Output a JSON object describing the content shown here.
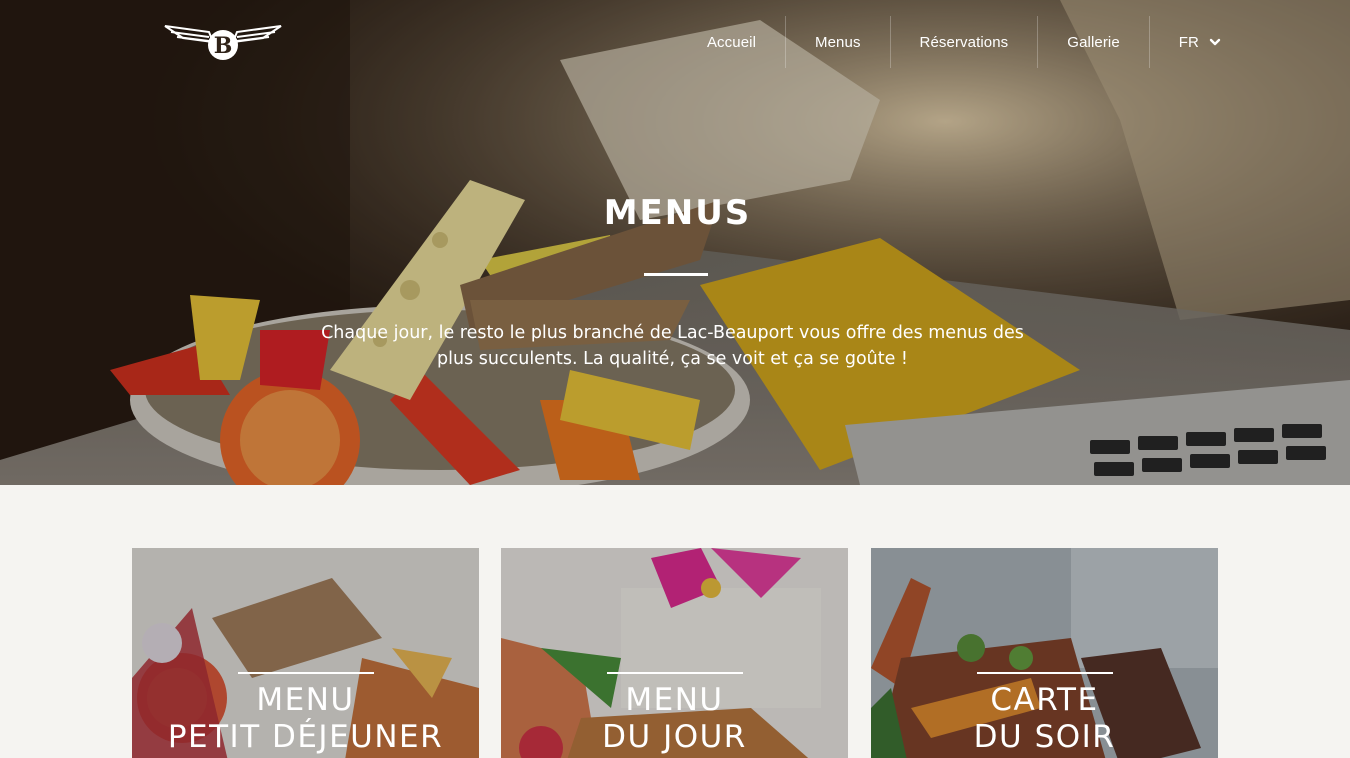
{
  "nav": {
    "items": [
      {
        "label": "Accueil"
      },
      {
        "label": "Menus"
      },
      {
        "label": "Réservations"
      },
      {
        "label": "Gallerie"
      }
    ],
    "language": "FR"
  },
  "hero": {
    "title": "MENUS",
    "text": "Chaque jour, le resto le plus branché de Lac-Beauport vous offre des  menus des plus succulents. La qualité, ça se voit et ça se goûte !"
  },
  "cards": [
    {
      "line1": "MENU",
      "line2": "PETIT DÉJEUNER"
    },
    {
      "line1": "MENU",
      "line2": "DU JOUR"
    },
    {
      "line1": "CARTE",
      "line2": "DU SOIR"
    }
  ],
  "colors": {
    "background": "#f5f4f1",
    "text_on_image": "#ffffff"
  }
}
